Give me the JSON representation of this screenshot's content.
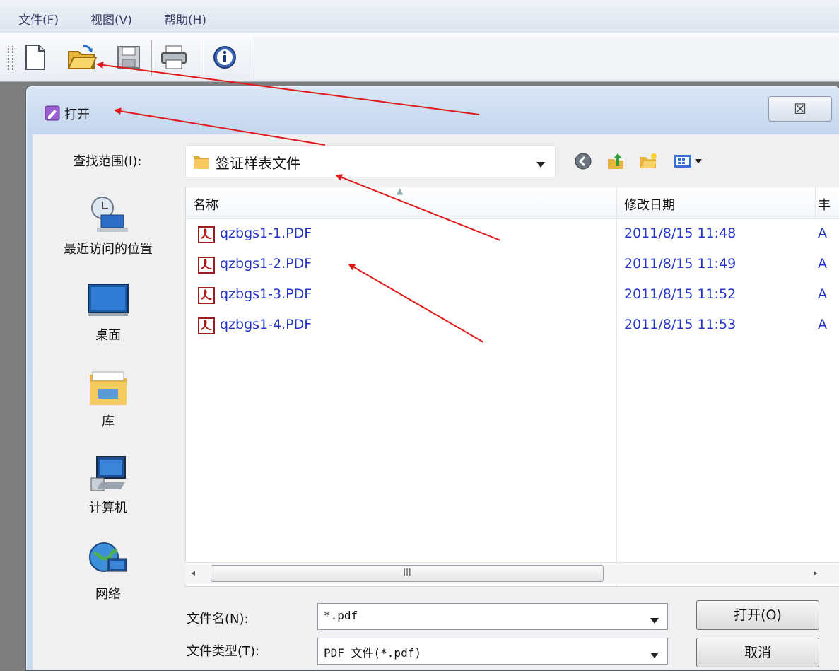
{
  "menu": {
    "file": "文件(F)",
    "view": "视图(V)",
    "help": "帮助(H)"
  },
  "toolbar": {
    "icons": [
      "new-document-icon",
      "open-folder-icon",
      "save-icon",
      "print-icon",
      "info-icon"
    ]
  },
  "dialog": {
    "title": "打开",
    "close_glyph": "☒",
    "look_in_label": "查找范围(I):",
    "look_in_value": "签证样表文件",
    "nav_icons": [
      "back-icon",
      "up-folder-icon",
      "new-folder-icon",
      "view-menu-icon"
    ]
  },
  "places": [
    {
      "label": "最近访问的位置",
      "icon": "recent-places-icon"
    },
    {
      "label": "桌面",
      "icon": "desktop-icon"
    },
    {
      "label": "库",
      "icon": "libraries-icon"
    },
    {
      "label": "计算机",
      "icon": "computer-icon"
    },
    {
      "label": "网络",
      "icon": "network-icon"
    }
  ],
  "columns": {
    "name": "名称",
    "date": "修改日期",
    "third": "丰"
  },
  "files": [
    {
      "name": "qzbgs1-1.PDF",
      "date": "2011/8/15 11:48",
      "cut": "A"
    },
    {
      "name": "qzbgs1-2.PDF",
      "date": "2011/8/15 11:49",
      "cut": "A"
    },
    {
      "name": "qzbgs1-3.PDF",
      "date": "2011/8/15 11:52",
      "cut": "A"
    },
    {
      "name": "qzbgs1-4.PDF",
      "date": "2011/8/15 11:53",
      "cut": "A"
    }
  ],
  "scrollbar": {
    "left": "◂",
    "thumb": "III",
    "right": "▸"
  },
  "filename": {
    "label": "文件名(N):",
    "value": "*.pdf"
  },
  "filetype": {
    "label": "文件类型(T):",
    "value": "PDF 文件(*.pdf)"
  },
  "buttons": {
    "open": "打开(O)",
    "cancel": "取消"
  },
  "colors": {
    "file_text": "#2433c8",
    "annotation_arrow": "#e01a1a"
  }
}
